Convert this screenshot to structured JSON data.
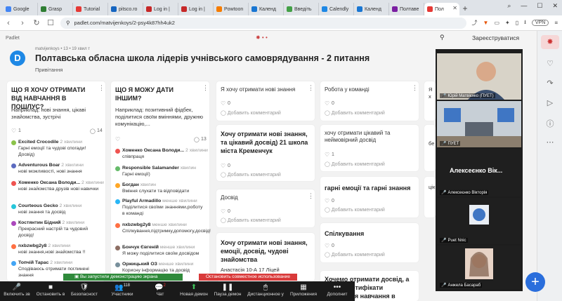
{
  "browser": {
    "tabs": [
      {
        "label": "Google",
        "color": "#4285f4"
      },
      {
        "label": "Grasp",
        "color": "#2e7d32"
      },
      {
        "label": "Tutorial",
        "color": "#e53935"
      },
      {
        "label": "pitsco.ro",
        "color": "#1565c0"
      },
      {
        "label": "Log in |",
        "color": "#c62828"
      },
      {
        "label": "Log in |",
        "color": "#c62828"
      },
      {
        "label": "Powtoon",
        "color": "#f57c00"
      },
      {
        "label": "Календ",
        "color": "#1976d2"
      },
      {
        "label": "Введіть",
        "color": "#43a047"
      },
      {
        "label": "Calendly",
        "color": "#1e88e5"
      },
      {
        "label": "Календ",
        "color": "#1976d2"
      },
      {
        "label": "Полтаве",
        "color": "#7b1fa2"
      },
      {
        "label": "Пол",
        "color": "#e53935"
      }
    ],
    "new_tab": "+",
    "win": {
      "search": "⌕",
      "minimize": "—",
      "maximize": "☐",
      "close": "✕"
    },
    "url": "padlet.com/matvijenkoys/2-psy4k87hh4uk2",
    "vpn": "VPN"
  },
  "padlet": {
    "brand": "Padlet",
    "signup": "Зареєструватися",
    "meta": "matvijenkoys • 13 • 19 хвил т",
    "title": "Полтавська обласна школа лідерів учнівського самоврядування - 2 питання",
    "subtitle": "Привітання",
    "logo_letter": "D"
  },
  "col1": {
    "title": "ЩО Я ХОЧУ ОТРИМАТИ ВІД НАВЧАННЯ В ПОШЛУС?",
    "text": "Наприклад: нові знання, цікаві знайомства, зустрічі",
    "likes": "1",
    "comments": "14",
    "items": [
      {
        "name": "Excited Crocodile",
        "time": "2 хвилини",
        "text": "Гарні емоції та чудові спогади! Досвід)",
        "color": "#8bc34a"
      },
      {
        "name": "Adventurous Boar",
        "time": "2 хвилини",
        "text": "нові можливості, нові знання",
        "color": "#5c6bc0"
      },
      {
        "name": "Хоменко Оксана Володи...",
        "time": "2 хвилини",
        "text": "нові знайомства друзів нові навички",
        "color": "#ef5350"
      },
      {
        "name": "Courteous Gecko",
        "time": "2 хвилини",
        "text": "нові знання та досвід",
        "color": "#26c6da"
      },
      {
        "name": "Костянтин Бідний",
        "time": "2 хвилини",
        "text": "Прекрасний настрій та чудовий досвід!",
        "color": "#ab47bc"
      },
      {
        "name": "nxbzwbg2y8",
        "time": "2 хвилини",
        "text": "нові знання,нові знайомства !!",
        "color": "#ff7043"
      },
      {
        "name": "Топчій Тарас",
        "time": "2 хвилини",
        "text": "Сподіваюсь отримати поглинені знання",
        "color": "#42a5f5"
      }
    ]
  },
  "col2": {
    "title": "ЩО Я МОЖУ ДАТИ ІНШИМ?",
    "text": "Наприклад: позитивний фідбек, поділитися своїм вміннями, дружню комунікацію,...",
    "likes": "",
    "comments": "13",
    "items": [
      {
        "name": "Хоменко Оксана Володи...",
        "time": "2 хвилини",
        "text": "співпраця",
        "color": "#ef5350"
      },
      {
        "name": "Responsible Salamander",
        "time": "хвилин",
        "text": "Гарні емоції)",
        "color": "#66bb6a"
      },
      {
        "name": "Богдан",
        "time": "хвилин",
        "text": "Вміння слухати та відповідати",
        "color": "#ffa726"
      },
      {
        "name": "Playful Armadillo",
        "time": "менше хвилини",
        "text": "Поділитися своїми знаннями,роботу в команді",
        "color": "#29b6f6"
      },
      {
        "name": "nxbzwbg2y8",
        "time": "менше хвилини",
        "text": "Спілкування,підтримку,допомогу,досвід!",
        "color": "#ff7043"
      },
      {
        "name": "Бончук Євгеній",
        "time": "менше хвилини",
        "text": "Я можу поділитися своїм досвідом",
        "color": "#8d6e63"
      },
      {
        "name": "Оржицький ОЗ",
        "time": "менше хвилини",
        "text": "Корисну інформацію та досвід",
        "color": "#78909c"
      }
    ]
  },
  "col3": {
    "c1": "Я хочу отримати нові знання",
    "c2": "Хочу отримати нові знання, та цікавий досвід) 21 школа міста Кременчук",
    "c3": "Досвід",
    "c4": "Хочу отримати нові знання, емоції, досвід, чудові знайомства",
    "c4sub": "Анастасія 10-А 17 Ліцей",
    "add": "Добавить комментарий",
    "zero": "0",
    "one": "1"
  },
  "col4": {
    "c1": "Робота у команді",
    "c2": "хочу отримати цікавий та неймовірний досвід",
    "c3": "гарні емоції та гарні знання",
    "c4": "Спілкування",
    "c5": "Хочемо отримати досвід, а також сертифікати закінчення навчання в",
    "add": "Добавить комментарий",
    "zero": "0",
    "one": "1"
  },
  "col5": {
    "c1": "Я х",
    "c2": "бе",
    "c3": "цік",
    "c4": "отр",
    "c5": "бе",
    "add": "Д",
    "zero": "0"
  },
  "zoom": {
    "p1": "Юрій Матвієнко (ПУЕТ)",
    "p2": "ПУЕТ",
    "p3_big": "Алексеєнко Вік...",
    "p3": "Алексеєнко Вікторія",
    "p4": "Puet Nnic",
    "p5": "Анжела Басараб",
    "share_msg": "Вы запустили демонстрацию экрана",
    "stop_share": "Остановить совместное использование",
    "controls": [
      {
        "label": "Включить зв",
        "icon": "🎤"
      },
      {
        "label": "Остановить в",
        "icon": "■"
      },
      {
        "label": "Безопасност",
        "icon": "🛡"
      },
      {
        "label": "Участники",
        "icon": "👥",
        "badge": "118"
      },
      {
        "label": "Чат",
        "icon": "💬",
        "badge": "2"
      },
      {
        "label": "Новая демон",
        "icon": "⬆",
        "green": true
      },
      {
        "label": "Пауза демон",
        "icon": "❚❚"
      },
      {
        "label": "Дистанционное у",
        "icon": "🖱"
      },
      {
        "label": "Приложения",
        "icon": "▦"
      },
      {
        "label": "Дополнит",
        "icon": "•••"
      }
    ]
  }
}
